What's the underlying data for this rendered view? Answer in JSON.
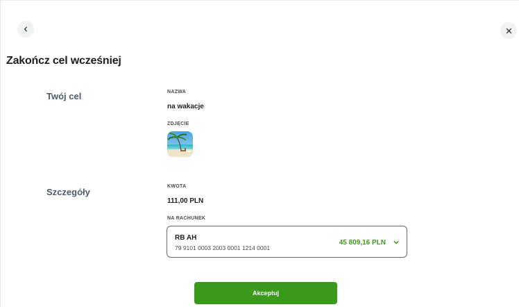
{
  "header": {
    "back_icon": "chevron-left-icon",
    "close_icon": "close-icon",
    "title": "Zakończ cel wcześniej"
  },
  "goal_section": {
    "label": "Twój cel",
    "name_label": "NAZWA",
    "name_value": "na wakacje",
    "photo_label": "ZDJĘCIE",
    "photo_icon": "beach-photo"
  },
  "details_section": {
    "label": "Szczegóły",
    "amount_label": "KWOTA",
    "amount_value": "111,00 PLN",
    "account_label": "NA RACHUNEK",
    "account": {
      "name": "RB AH",
      "number": "79 9101 0003 2003 0001 1214 0001",
      "balance": "45 809,16 PLN",
      "chevron_icon": "chevron-down-icon"
    }
  },
  "actions": {
    "accept_label": "Akceptuj"
  },
  "colors": {
    "accent_green": "#3a9a1c",
    "section_label": "#4f5b6b",
    "icon_button_bg": "#f1f2f4"
  }
}
